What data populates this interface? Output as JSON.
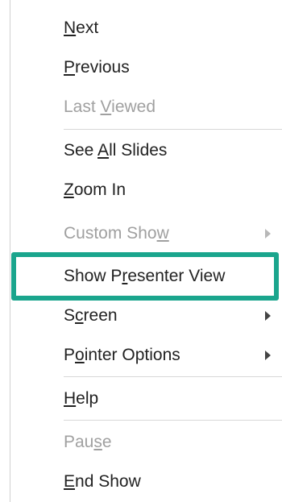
{
  "menu": {
    "items": [
      {
        "label_pre": "",
        "label_key": "N",
        "label_post": "ext",
        "disabled": false,
        "submenu": false
      },
      {
        "label_pre": "",
        "label_key": "P",
        "label_post": "revious",
        "disabled": false,
        "submenu": false
      },
      {
        "label_pre": "Last ",
        "label_key": "V",
        "label_post": "iewed",
        "disabled": true,
        "submenu": false
      },
      {
        "label_pre": "See ",
        "label_key": "A",
        "label_post": "ll Slides",
        "disabled": false,
        "submenu": false
      },
      {
        "label_pre": "",
        "label_key": "Z",
        "label_post": "oom In",
        "disabled": false,
        "submenu": false
      },
      {
        "label_pre": "Custom Sho",
        "label_key": "w",
        "label_post": "",
        "disabled": true,
        "submenu": true
      },
      {
        "label_pre": "Show P",
        "label_key": "r",
        "label_post": "esenter View",
        "disabled": false,
        "submenu": false
      },
      {
        "label_pre": "S",
        "label_key": "c",
        "label_post": "reen",
        "disabled": false,
        "submenu": true
      },
      {
        "label_pre": "P",
        "label_key": "o",
        "label_post": "inter Options",
        "disabled": false,
        "submenu": true
      },
      {
        "label_pre": "",
        "label_key": "H",
        "label_post": "elp",
        "disabled": false,
        "submenu": false
      },
      {
        "label_pre": "Pau",
        "label_key": "s",
        "label_post": "e",
        "disabled": true,
        "submenu": false
      },
      {
        "label_pre": "",
        "label_key": "E",
        "label_post": "nd Show",
        "disabled": false,
        "submenu": false
      }
    ]
  },
  "colors": {
    "highlight_border": "#1aa58d",
    "text": "#222222",
    "disabled_text": "#a0a0a0"
  }
}
